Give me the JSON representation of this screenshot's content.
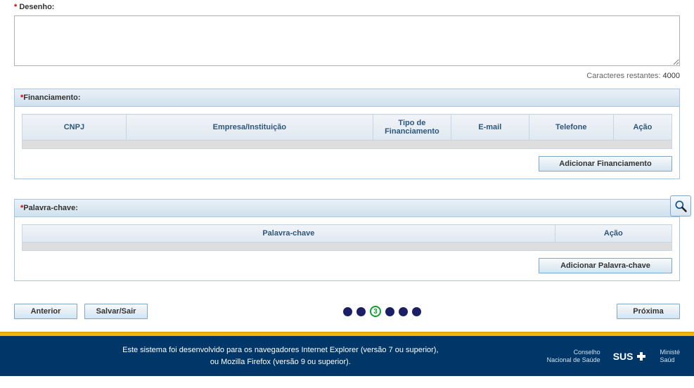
{
  "design": {
    "label": "Desenho:",
    "value": "",
    "char_label": "Caracteres restantes:",
    "char_value": "4000"
  },
  "financing": {
    "title": "Financiamento:",
    "headers": [
      "CNPJ",
      "Empresa/Instituição",
      "Tipo de Financiamento",
      "E-mail",
      "Telefone",
      "Ação"
    ],
    "add_button": "Adicionar Financiamento"
  },
  "keyword": {
    "title": "Palavra-chave:",
    "headers": [
      "Palavra-chave",
      "Ação"
    ],
    "add_button": "Adicionar Palavra-chave"
  },
  "nav": {
    "prev": "Anterior",
    "save": "Salvar/Sair",
    "next": "Próxima",
    "active_step": "3"
  },
  "footer": {
    "line1": "Este sistema foi desenvolvido para os navegadores Internet Explorer (versão 7 ou superior),",
    "line2": "ou Mozilla Firefox (versão 9 ou superior).",
    "conselho_top": "Conselho",
    "conselho_bot": "Nacional de Saúde",
    "sus": "SUS",
    "minist_top": "Ministé",
    "minist_bot": "Saúd"
  }
}
